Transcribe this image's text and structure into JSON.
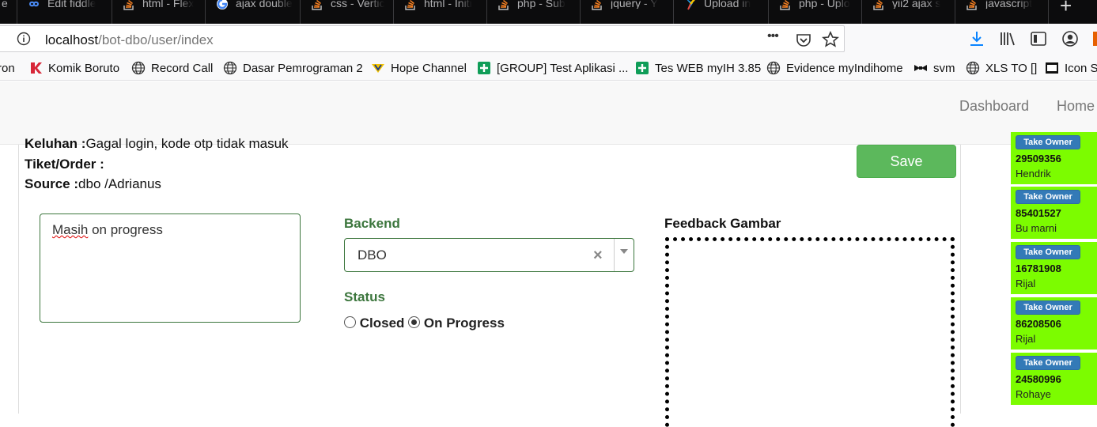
{
  "browser": {
    "tabs": [
      {
        "title": "Edit fiddle",
        "icon": "jsfiddle-icon",
        "color": "#4b8cf5"
      },
      {
        "title": "html - Flex",
        "icon": "stackoverflow-icon",
        "color": "#f48024"
      },
      {
        "title": "ajax double",
        "icon": "google-icon",
        "color": "#4285f4"
      },
      {
        "title": "css - Vertic",
        "icon": "stackoverflow-icon",
        "color": "#f48024"
      },
      {
        "title": "html - Initi",
        "icon": "stackoverflow-icon",
        "color": "#f48024"
      },
      {
        "title": "php - Sub",
        "icon": "stackoverflow-icon",
        "color": "#f48024"
      },
      {
        "title": "jquery - Y",
        "icon": "stackoverflow-icon",
        "color": "#f48024"
      },
      {
        "title": "Upload in",
        "icon": "yii-icon",
        "color": "#1da1f2"
      },
      {
        "title": "php - Uplo",
        "icon": "stackoverflow-icon",
        "color": "#f48024"
      },
      {
        "title": "yii2 ajax s",
        "icon": "stackoverflow-icon",
        "color": "#f48024"
      },
      {
        "title": "javascript",
        "icon": "stackoverflow-icon",
        "color": "#f48024"
      }
    ],
    "new_tab": "+",
    "url_host": "localhost",
    "url_path": "/bot-dbo/user/index",
    "url_more": "•••",
    "bookmarks": [
      {
        "label": "ron",
        "icon": "none"
      },
      {
        "label": "Komik Boruto",
        "icon": "komik-icon"
      },
      {
        "label": "Record Call",
        "icon": "globe-icon"
      },
      {
        "label": "Dasar Pemrograman 2",
        "icon": "globe-icon"
      },
      {
        "label": "Hope Channel",
        "icon": "hope-channel-icon"
      },
      {
        "label": "[GROUP] Test Aplikasi ...",
        "icon": "sheets-icon"
      },
      {
        "label": "Tes WEB myIH 3.85",
        "icon": "sheets-icon"
      },
      {
        "label": "Evidence myIndihome",
        "icon": "globe-icon"
      },
      {
        "label": "svm",
        "icon": "bowtie-icon"
      },
      {
        "label": "XLS TO []",
        "icon": "globe-icon"
      },
      {
        "label": "Icon S",
        "icon": "terminal-icon"
      }
    ]
  },
  "header": {
    "nav": [
      "Dashboard",
      "Home"
    ]
  },
  "ticket": {
    "keluhan_label": "Keluhan :",
    "keluhan_value": "Gagal login, kode otp tidak masuk",
    "tiket_label": "Tiket/Order :",
    "tiket_value": "",
    "source_label": "Source :",
    "source_value": "dbo /Adrianus",
    "save_label": "Save",
    "notes_word1": "Masih",
    "notes_rest": " on progress",
    "backend_label": "Backend",
    "backend_value": "DBO",
    "status_label": "Status",
    "status_options": [
      "Closed",
      "On Progress"
    ],
    "status_selected": "On Progress",
    "feedback_label": "Feedback Gambar"
  },
  "queue": {
    "take_owner_label": "Take Owner",
    "items": [
      {
        "number": "29509356",
        "name": "Hendrik"
      },
      {
        "number": "85401527",
        "name": "Bu marni"
      },
      {
        "number": "16781908",
        "name": "Rijal"
      },
      {
        "number": "86208506",
        "name": "Rijal"
      },
      {
        "number": "24580996",
        "name": "Rohaye"
      }
    ],
    "item_color": "#7cfc00"
  }
}
